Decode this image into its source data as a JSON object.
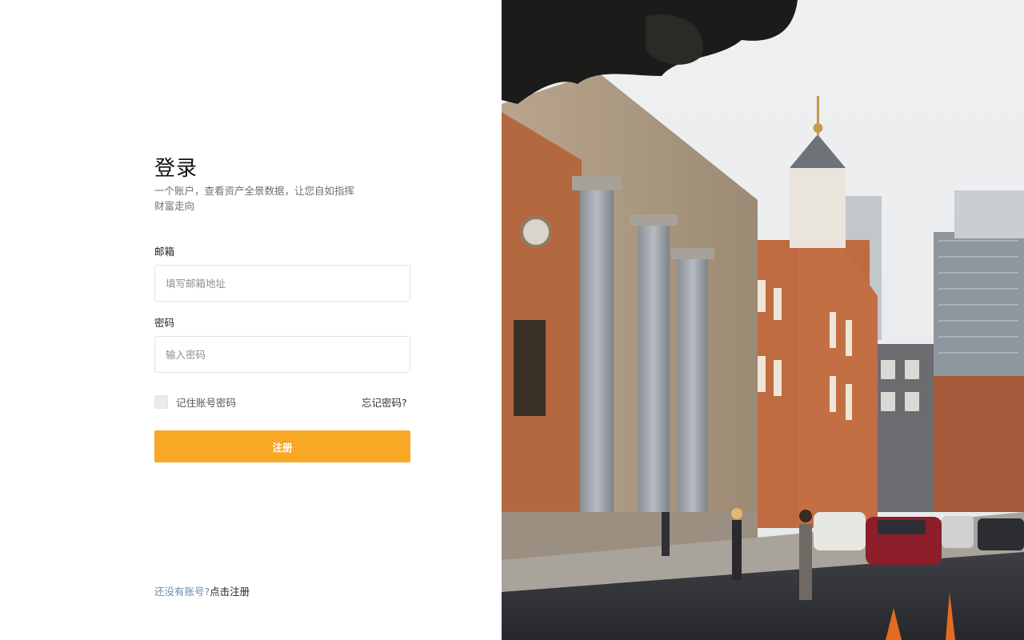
{
  "login": {
    "title": "登录",
    "subtitle": "一个账户，查看资产全景数据，让您自如指挥财富走向",
    "email_label": "邮箱",
    "email_placeholder": "填写邮箱地址",
    "email_value": "",
    "password_label": "密码",
    "password_placeholder": "输入密码",
    "password_value": "",
    "remember_label": "记住账号密码",
    "forgot_label": "忘记密码?",
    "submit_label": "注册",
    "footer_question": "还没有账号?",
    "footer_link": "点击注册"
  },
  "colors": {
    "accent": "#f9a825",
    "footer_question": "#6a8bb0"
  },
  "hero_image": {
    "description_icon": "city-street-photo"
  }
}
